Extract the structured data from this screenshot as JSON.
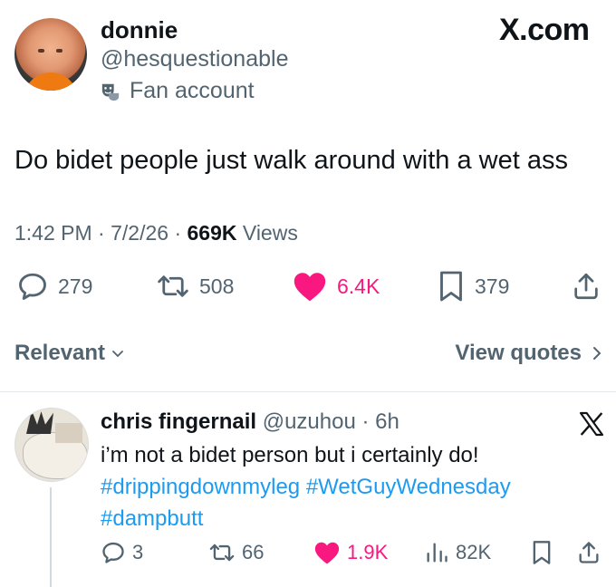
{
  "main_tweet": {
    "display_name": "donnie",
    "handle": "@hesquestionable",
    "label": "Fan account",
    "site": "X.com",
    "text": "Do bidet people just walk around with a wet ass",
    "time": "1:42 PM",
    "date": "7/2/26",
    "views_count": "669K",
    "views_label": "Views",
    "replies": "279",
    "reposts": "508",
    "likes": "6.4K",
    "bookmarks": "379"
  },
  "sort": {
    "relevant_label": "Relevant",
    "view_quotes_label": "View quotes"
  },
  "reply": {
    "display_name": "chris fingernail",
    "handle": "@uzuhou",
    "time": "6h",
    "line1": "i’m not a bidet person but i certainly do!",
    "hashtags_line2": [
      "#drippingdownmyleg",
      "#WetGuyWednesday"
    ],
    "hashtags_line3": [
      "#dampbutt"
    ],
    "replies": "3",
    "reposts": "66",
    "likes": "1.9K",
    "views": "82K"
  },
  "colors": {
    "like_pink": "#f91880",
    "hashtag_blue": "#1d9bf0",
    "muted_gray": "#536471"
  }
}
